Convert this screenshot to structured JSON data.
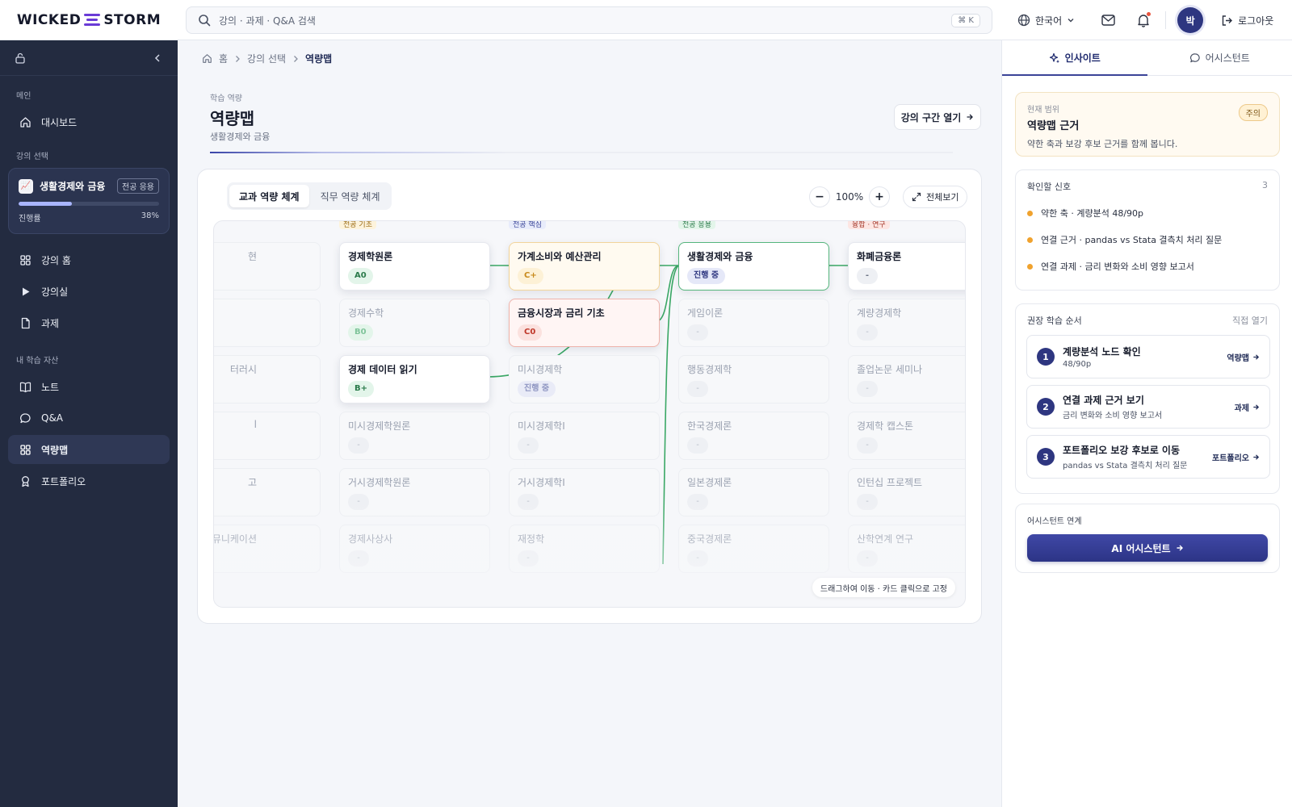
{
  "brand": {
    "name_left": "WICKED",
    "name_right": "STORM",
    "accent": "#6a3bd6"
  },
  "search": {
    "placeholder": "강의 · 과제 · Q&A 검색",
    "shortcut": "⌘ K"
  },
  "header": {
    "language": "한국어",
    "avatar_initial": "박",
    "logout": "로그아웃"
  },
  "sidebar": {
    "sections": {
      "main": "메인",
      "course": "강의 선택",
      "assets": "내 학습 자산"
    },
    "dashboard": "대시보드",
    "course": {
      "name": "생활경제와 금융",
      "tag": "전공 응용",
      "progress_label": "진행률",
      "progress_text": "38%",
      "progress": 0.38
    },
    "items": {
      "course_home": "강의 홈",
      "classroom": "강의실",
      "assignment": "과제",
      "notes": "노트",
      "qa": "Q&A",
      "competency": "역량맵",
      "portfolio": "포트폴리오"
    }
  },
  "breadcrumb": {
    "home": "홈",
    "course": "강의 선택",
    "current": "역량맵"
  },
  "page": {
    "kicker": "학습 역량",
    "title": "역량맵",
    "subtitle": "생활경제와 금융",
    "open_section": "강의 구간 열기"
  },
  "board": {
    "tabs": [
      "교과 역량 체계",
      "직무 역량 체계"
    ],
    "zoom": "100%",
    "fullscreen": "전체보기",
    "hint": "드래그하여 이동 · 카드 클릭으로 고정",
    "column_tags": [
      "전공 기초",
      "전공 핵심",
      "전공 응용",
      "융합 · 연구"
    ],
    "col0": [
      "현",
      "",
      "터러시",
      "l",
      "고",
      "뮤니케이션"
    ],
    "nodes": [
      {
        "title": "경제학원론",
        "badge": "A0"
      },
      {
        "title": "경제수학",
        "badge": "B0"
      },
      {
        "title": "경제 데이터 읽기",
        "badge": "B+"
      },
      {
        "title": "미시경제학원론",
        "badge": "-"
      },
      {
        "title": "거시경제학원론",
        "badge": "-"
      },
      {
        "title": "경제사상사",
        "badge": "-"
      },
      {
        "title": "가계소비와 예산관리",
        "badge": "C+"
      },
      {
        "title": "금융시장과 금리 기초",
        "badge": "C0"
      },
      {
        "title": "미시경제학",
        "badge": "진행 중"
      },
      {
        "title": "미시경제학I",
        "badge": "-"
      },
      {
        "title": "거시경제학I",
        "badge": "-"
      },
      {
        "title": "재정학",
        "badge": "-"
      },
      {
        "title": "생활경제와 금융",
        "badge": "진행 중"
      },
      {
        "title": "게임이론",
        "badge": "-"
      },
      {
        "title": "행동경제학",
        "badge": "-"
      },
      {
        "title": "한국경제론",
        "badge": "-"
      },
      {
        "title": "일본경제론",
        "badge": "-"
      },
      {
        "title": "중국경제론",
        "badge": "-"
      },
      {
        "title": "화폐금융론",
        "badge": "-"
      },
      {
        "title": "계량경제학",
        "badge": "-"
      },
      {
        "title": "졸업논문 세미나",
        "badge": "-"
      },
      {
        "title": "경제학 캡스톤",
        "badge": "-"
      },
      {
        "title": "인턴십 프로젝트",
        "badge": "-"
      },
      {
        "title": "산학연계 연구",
        "badge": "-"
      }
    ]
  },
  "panel": {
    "tabs": {
      "insight": "인사이트",
      "assistant": "어시스턴트"
    },
    "scope": {
      "kicker": "현재 범위",
      "title": "역량맵 근거",
      "desc": "약한 축과 보강 후보 근거를 함께 봅니다.",
      "badge": "주의"
    },
    "signals": {
      "title": "확인할 신호",
      "count": "3",
      "items": [
        "약한 축 · 계량분석 48/90p",
        "연결 근거 · pandas vs Stata 결측치 처리 질문",
        "연결 과제 · 금리 변화와 소비 영향 보고서"
      ]
    },
    "order": {
      "title": "권장 학습 순서",
      "action": "직접 열기",
      "steps": [
        {
          "num": "1",
          "title": "계량분석 노드 확인",
          "sub": "48/90p",
          "go": "역량맵"
        },
        {
          "num": "2",
          "title": "연결 과제 근거 보기",
          "sub": "금리 변화와 소비 영향 보고서",
          "go": "과제"
        },
        {
          "num": "3",
          "title": "포트폴리오 보강 후보로 이동",
          "sub": "pandas vs Stata 결측치 처리 질문",
          "go": "포트폴리오"
        }
      ]
    },
    "assist": {
      "title": "어시스턴트 연계",
      "button": "AI 어시스턴트"
    }
  }
}
